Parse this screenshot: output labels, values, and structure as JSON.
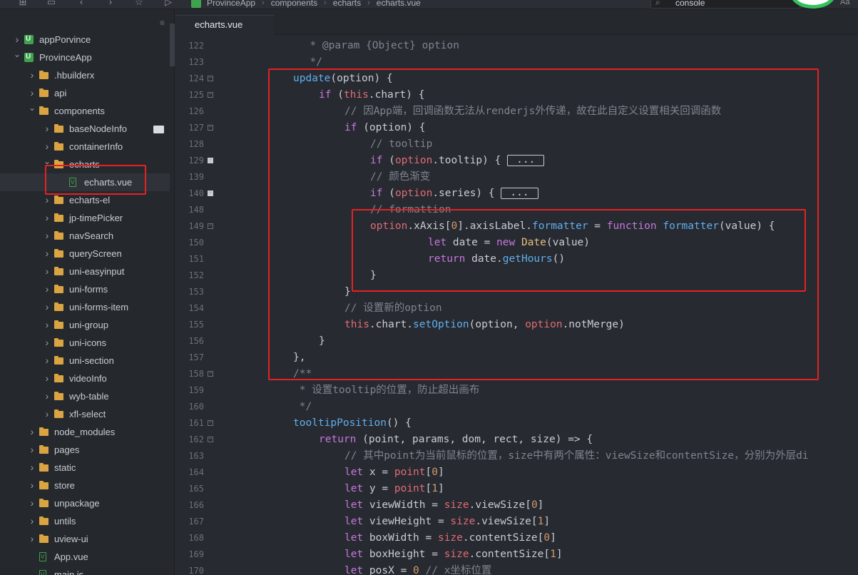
{
  "breadcrumb": [
    "ProvinceApp",
    "components",
    "echarts",
    "echarts.vue"
  ],
  "search": {
    "value": "console"
  },
  "font_toggle_label": "Aa",
  "tabs": [
    {
      "label": "echarts.vue",
      "active": true
    }
  ],
  "tree": [
    {
      "label": "appPorvince",
      "depth": 0,
      "expanded": false,
      "icon": "project-icon"
    },
    {
      "label": "ProvinceApp",
      "depth": 0,
      "expanded": true,
      "icon": "project-icon"
    },
    {
      "label": ".hbuilderx",
      "depth": 1,
      "expanded": false,
      "icon": "folder-icon"
    },
    {
      "label": "api",
      "depth": 1,
      "expanded": false,
      "icon": "folder-icon"
    },
    {
      "label": "components",
      "depth": 1,
      "expanded": true,
      "icon": "folder-icon"
    },
    {
      "label": "baseNodeInfo",
      "depth": 2,
      "expanded": false,
      "icon": "folder-icon"
    },
    {
      "label": "containerInfo",
      "depth": 2,
      "expanded": false,
      "icon": "folder-icon"
    },
    {
      "label": "echarts",
      "depth": 2,
      "expanded": true,
      "icon": "folder-icon"
    },
    {
      "label": "echarts.vue",
      "depth": 3,
      "expanded": null,
      "icon": "vue-file-icon",
      "selected": true
    },
    {
      "label": "echarts-el",
      "depth": 2,
      "expanded": false,
      "icon": "folder-icon"
    },
    {
      "label": "jp-timePicker",
      "depth": 2,
      "expanded": false,
      "icon": "folder-icon"
    },
    {
      "label": "navSearch",
      "depth": 2,
      "expanded": false,
      "icon": "folder-icon"
    },
    {
      "label": "queryScreen",
      "depth": 2,
      "expanded": false,
      "icon": "folder-icon"
    },
    {
      "label": "uni-easyinput",
      "depth": 2,
      "expanded": false,
      "icon": "folder-icon"
    },
    {
      "label": "uni-forms",
      "depth": 2,
      "expanded": false,
      "icon": "folder-icon"
    },
    {
      "label": "uni-forms-item",
      "depth": 2,
      "expanded": false,
      "icon": "folder-icon"
    },
    {
      "label": "uni-group",
      "depth": 2,
      "expanded": false,
      "icon": "folder-icon"
    },
    {
      "label": "uni-icons",
      "depth": 2,
      "expanded": false,
      "icon": "folder-icon"
    },
    {
      "label": "uni-section",
      "depth": 2,
      "expanded": false,
      "icon": "folder-icon"
    },
    {
      "label": "videoInfo",
      "depth": 2,
      "expanded": false,
      "icon": "folder-icon"
    },
    {
      "label": "wyb-table",
      "depth": 2,
      "expanded": false,
      "icon": "folder-icon"
    },
    {
      "label": "xfl-select",
      "depth": 2,
      "expanded": false,
      "icon": "folder-icon"
    },
    {
      "label": "node_modules",
      "depth": 1,
      "expanded": false,
      "icon": "folder-icon"
    },
    {
      "label": "pages",
      "depth": 1,
      "expanded": false,
      "icon": "folder-icon"
    },
    {
      "label": "static",
      "depth": 1,
      "expanded": false,
      "icon": "folder-icon"
    },
    {
      "label": "store",
      "depth": 1,
      "expanded": false,
      "icon": "folder-icon"
    },
    {
      "label": "unpackage",
      "depth": 1,
      "expanded": false,
      "icon": "folder-icon"
    },
    {
      "label": "untils",
      "depth": 1,
      "expanded": false,
      "icon": "folder-icon"
    },
    {
      "label": "uview-ui",
      "depth": 1,
      "expanded": false,
      "icon": "folder-icon"
    },
    {
      "label": "App.vue",
      "depth": 1,
      "expanded": null,
      "icon": "vue-file-icon"
    },
    {
      "label": "main.js",
      "depth": 1,
      "expanded": null,
      "icon": "js-file-icon"
    }
  ],
  "code_lines": [
    {
      "num": "122",
      "fold": "",
      "html": "  * @param {Object} option",
      "cls": "cmt"
    },
    {
      "num": "123",
      "fold": "",
      "html": "  */",
      "cls": "cmt"
    },
    {
      "num": "124",
      "fold": "minus",
      "segments": [
        [
          "update",
          "fn"
        ],
        [
          "(option) {",
          ""
        ]
      ],
      "indent": 0
    },
    {
      "num": "125",
      "fold": "minus",
      "segments": [
        [
          "if",
          "kw"
        ],
        [
          " (",
          ""
        ],
        [
          "this",
          "prop"
        ],
        [
          ".chart) {",
          ""
        ]
      ],
      "indent": 1
    },
    {
      "num": "126",
      "fold": "",
      "segments": [
        [
          "// 因App端，回调函数无法从renderjs外传递，故在此自定义设置相关回调函数",
          "cmt"
        ]
      ],
      "indent": 2
    },
    {
      "num": "127",
      "fold": "minus",
      "segments": [
        [
          "if",
          "kw"
        ],
        [
          " (option) {",
          ""
        ]
      ],
      "indent": 2
    },
    {
      "num": "128",
      "fold": "",
      "segments": [
        [
          "// tooltip",
          "cmt"
        ]
      ],
      "indent": 3
    },
    {
      "num": "129",
      "fold": "plus",
      "segments": [
        [
          "if",
          "kw"
        ],
        [
          " (",
          ""
        ],
        [
          "option",
          "prop"
        ],
        [
          ".tooltip) { ",
          ""
        ],
        [
          "...",
          "ellip"
        ]
      ],
      "indent": 3
    },
    {
      "num": "139",
      "fold": "",
      "segments": [
        [
          "// 颜色渐变",
          "cmt"
        ]
      ],
      "indent": 3
    },
    {
      "num": "140",
      "fold": "plus",
      "segments": [
        [
          "if",
          "kw"
        ],
        [
          " (",
          ""
        ],
        [
          "option",
          "prop"
        ],
        [
          ".series) { ",
          ""
        ],
        [
          "...",
          "ellip"
        ]
      ],
      "indent": 3
    },
    {
      "num": "148",
      "fold": "",
      "segments": [
        [
          "// formattion",
          "cmt"
        ]
      ],
      "indent": 3
    },
    {
      "num": "149",
      "fold": "minus",
      "segments": [
        [
          "option",
          "prop"
        ],
        [
          ".xAxis[",
          ""
        ],
        [
          "0",
          "num"
        ],
        [
          "].axisLabel.",
          ""
        ],
        [
          "formatter",
          "fn"
        ],
        [
          " = ",
          ""
        ],
        [
          "function",
          "kw"
        ],
        [
          " ",
          ""
        ],
        [
          "formatter",
          "fn"
        ],
        [
          "(value) {",
          ""
        ]
      ],
      "indent": 3
    },
    {
      "num": "150",
      "fold": "",
      "segments": [
        [
          "let",
          "kw"
        ],
        [
          " date = ",
          ""
        ],
        [
          "new",
          "kw"
        ],
        [
          " ",
          ""
        ],
        [
          "Date",
          "cls"
        ],
        [
          "(value)",
          ""
        ]
      ],
      "indent": 5.25
    },
    {
      "num": "151",
      "fold": "",
      "segments": [
        [
          "return",
          "kw"
        ],
        [
          " date.",
          ""
        ],
        [
          "getHours",
          "fn"
        ],
        [
          "()",
          ""
        ]
      ],
      "indent": 5.25
    },
    {
      "num": "152",
      "fold": "",
      "segments": [
        [
          "}",
          ""
        ]
      ],
      "indent": 3
    },
    {
      "num": "153",
      "fold": "",
      "segments": [
        [
          "}",
          ""
        ]
      ],
      "indent": 2
    },
    {
      "num": "154",
      "fold": "",
      "segments": [
        [
          "// 设置新的option",
          "cmt"
        ]
      ],
      "indent": 2
    },
    {
      "num": "155",
      "fold": "",
      "segments": [
        [
          "this",
          "prop"
        ],
        [
          ".chart.",
          ""
        ],
        [
          "setOption",
          "fn"
        ],
        [
          "(option, ",
          ""
        ],
        [
          "option",
          "prop"
        ],
        [
          ".notMerge)",
          ""
        ]
      ],
      "indent": 2
    },
    {
      "num": "156",
      "fold": "",
      "segments": [
        [
          "}",
          ""
        ]
      ],
      "indent": 1
    },
    {
      "num": "157",
      "fold": "",
      "segments": [
        [
          "},",
          ""
        ]
      ],
      "indent": 0
    },
    {
      "num": "158",
      "fold": "minus",
      "segments": [
        [
          "/**",
          "cmt"
        ]
      ],
      "indent": 0
    },
    {
      "num": "159",
      "fold": "",
      "segments": [
        [
          " * 设置tooltip的位置，防止超出画布",
          "cmt"
        ]
      ],
      "indent": 0
    },
    {
      "num": "160",
      "fold": "",
      "segments": [
        [
          " */",
          "cmt"
        ]
      ],
      "indent": 0
    },
    {
      "num": "161",
      "fold": "minus",
      "segments": [
        [
          "tooltipPosition",
          "fn"
        ],
        [
          "() {",
          ""
        ]
      ],
      "indent": 0
    },
    {
      "num": "162",
      "fold": "minus",
      "segments": [
        [
          "return",
          "kw"
        ],
        [
          " (point, params, dom, rect, size) => {",
          ""
        ]
      ],
      "indent": 1
    },
    {
      "num": "163",
      "fold": "",
      "segments": [
        [
          "// 其中point为当前鼠标的位置，size中有两个属性：viewSize和contentSize，分别为外层di",
          "cmt"
        ]
      ],
      "indent": 2
    },
    {
      "num": "164",
      "fold": "",
      "segments": [
        [
          "let",
          "kw"
        ],
        [
          " x = ",
          ""
        ],
        [
          "point",
          "prop"
        ],
        [
          "[",
          ""
        ],
        [
          "0",
          "num"
        ],
        [
          "]",
          ""
        ]
      ],
      "indent": 2
    },
    {
      "num": "165",
      "fold": "",
      "segments": [
        [
          "let",
          "kw"
        ],
        [
          " y = ",
          ""
        ],
        [
          "point",
          "prop"
        ],
        [
          "[",
          ""
        ],
        [
          "1",
          "num"
        ],
        [
          "]",
          ""
        ]
      ],
      "indent": 2
    },
    {
      "num": "166",
      "fold": "",
      "segments": [
        [
          "let",
          "kw"
        ],
        [
          " viewWidth = ",
          ""
        ],
        [
          "size",
          "prop"
        ],
        [
          ".viewSize[",
          ""
        ],
        [
          "0",
          "num"
        ],
        [
          "]",
          ""
        ]
      ],
      "indent": 2
    },
    {
      "num": "167",
      "fold": "",
      "segments": [
        [
          "let",
          "kw"
        ],
        [
          " viewHeight = ",
          ""
        ],
        [
          "size",
          "prop"
        ],
        [
          ".viewSize[",
          ""
        ],
        [
          "1",
          "num"
        ],
        [
          "]",
          ""
        ]
      ],
      "indent": 2
    },
    {
      "num": "168",
      "fold": "",
      "segments": [
        [
          "let",
          "kw"
        ],
        [
          " boxWidth = ",
          ""
        ],
        [
          "size",
          "prop"
        ],
        [
          ".contentSize[",
          ""
        ],
        [
          "0",
          "num"
        ],
        [
          "]",
          ""
        ]
      ],
      "indent": 2
    },
    {
      "num": "169",
      "fold": "",
      "segments": [
        [
          "let",
          "kw"
        ],
        [
          " boxHeight = ",
          ""
        ],
        [
          "size",
          "prop"
        ],
        [
          ".contentSize[",
          ""
        ],
        [
          "1",
          "num"
        ],
        [
          "]",
          ""
        ]
      ],
      "indent": 2
    },
    {
      "num": "170",
      "fold": "",
      "segments": [
        [
          "let",
          "kw"
        ],
        [
          " posX = ",
          ""
        ],
        [
          "0",
          "num"
        ],
        [
          " ",
          ""
        ],
        [
          "// x坐标位置",
          "cmt"
        ]
      ],
      "indent": 2
    }
  ]
}
